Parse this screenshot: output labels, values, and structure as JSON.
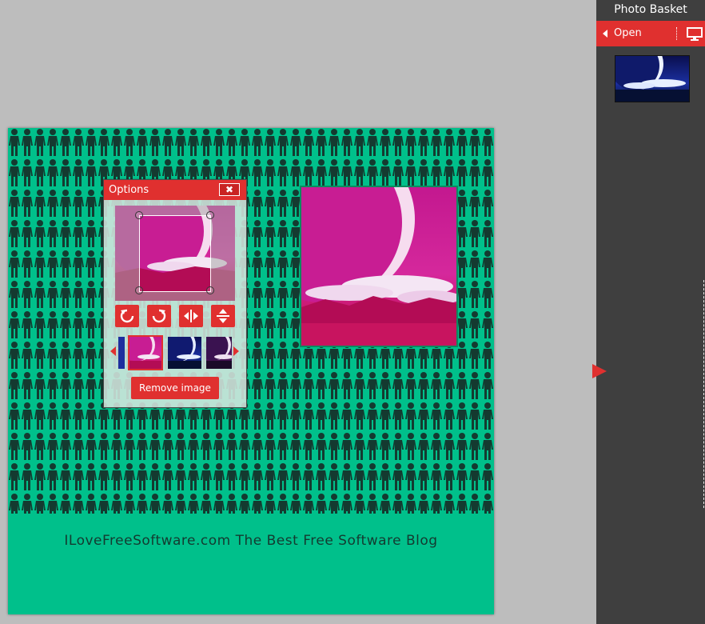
{
  "canvas": {
    "caption": "ILoveFreeSoftware.com The Best Free Software Blog",
    "background_color": "#00c08b",
    "pattern_color": "#143a30"
  },
  "options_dialog": {
    "title": "Options",
    "close_icon": "close-icon",
    "tools": [
      {
        "name": "rotate-left",
        "icon": "rotate-left-icon"
      },
      {
        "name": "rotate-right",
        "icon": "rotate-right-icon"
      },
      {
        "name": "flip-horizontal",
        "icon": "flip-horizontal-icon"
      },
      {
        "name": "flip-vertical",
        "icon": "flip-vertical-icon"
      }
    ],
    "filter_thumbnails": [
      "pink",
      "blue",
      "purple"
    ],
    "remove_label": "Remove image",
    "accent_color": "#e0302f"
  },
  "sidebar": {
    "title": "Photo Basket",
    "open_label": "Open",
    "monitor_icon": "monitor-icon"
  }
}
